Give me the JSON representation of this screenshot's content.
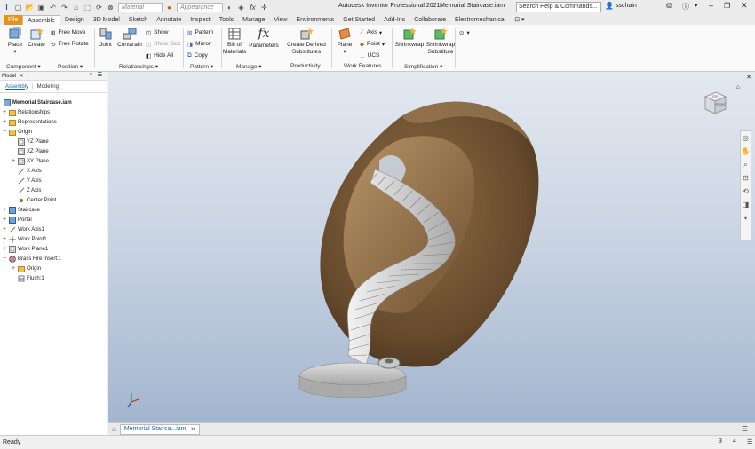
{
  "window": {
    "app_title": "Autodesk Inventor Professional 2021",
    "doc_title": "Memorial Staircase.iam",
    "search_placeholder": "Search Help & Commands...",
    "user": "sschain",
    "material_placeholder": "Material",
    "appearance_placeholder": "Appearance"
  },
  "tabs": [
    "File",
    "Assemble",
    "Design",
    "3D Model",
    "Sketch",
    "Annotate",
    "Inspect",
    "Tools",
    "Manage",
    "View",
    "Environments",
    "Get Started",
    "Add-Ins",
    "Collaborate",
    "Electromechanical"
  ],
  "active_tab": "Assemble",
  "ribbon": {
    "place": "Place",
    "create": "Create",
    "free_move": "Free Move",
    "free_rotate": "Free Rotate",
    "joint": "Joint",
    "constrain": "Constrain",
    "show": "Show",
    "show_sick": "Show Sick",
    "hide_all": "Hide All",
    "pattern": "Pattern",
    "mirror": "Mirror",
    "copy": "Copy",
    "bill_of_materials_1": "Bill of",
    "bill_of_materials_2": "Materials",
    "parameters": "Parameters",
    "create_derived_1": "Create Derived",
    "create_derived_2": "Substitutes",
    "plane": "Plane",
    "axis": "Axis",
    "point": "Point",
    "ucs": "UCS",
    "shrinkwrap": "Shrinkwrap",
    "shrinkwrap_sub_1": "Shrinkwrap",
    "shrinkwrap_sub_2": "Substitute",
    "panels": {
      "component": "Component ▾",
      "position": "Position ▾",
      "relationships": "Relationships ▾",
      "pattern": "Pattern ▾",
      "manage": "Manage ▾",
      "productivity": "Productivity",
      "work_features": "Work Features",
      "simplification": "Simplification ▾"
    }
  },
  "browser": {
    "title": "Model",
    "tab_assembly": "Assembly",
    "tab_modeling": "Modeling",
    "nodes": [
      {
        "label": "Memorial Staircase.iam",
        "icon": "assembly-icon"
      },
      {
        "label": "Relationships",
        "icon": "folder-icon"
      },
      {
        "label": "Representations",
        "icon": "folder-icon"
      },
      {
        "label": "Origin",
        "icon": "folder-icon"
      },
      {
        "label": "YZ Plane",
        "icon": "plane-icon"
      },
      {
        "label": "XZ Plane",
        "icon": "plane-icon"
      },
      {
        "label": "XY Plane",
        "icon": "plane-icon"
      },
      {
        "label": "X Axis",
        "icon": "axis-icon"
      },
      {
        "label": "Y Axis",
        "icon": "axis-icon"
      },
      {
        "label": "Z Axis",
        "icon": "axis-icon"
      },
      {
        "label": "Center Point",
        "icon": "point-icon"
      },
      {
        "label": "Staircase",
        "icon": "part-icon"
      },
      {
        "label": "Portal",
        "icon": "part-icon"
      },
      {
        "label": "Work Axis1",
        "icon": "axis-icon"
      },
      {
        "label": "Work Point1",
        "icon": "point-icon"
      },
      {
        "label": "Work Plane1",
        "icon": "plane-icon"
      },
      {
        "label": "Brass Fire Insert:1",
        "icon": "subassembly-icon"
      },
      {
        "label": "Origin",
        "icon": "folder-icon"
      },
      {
        "label": "Flush:1",
        "icon": "constraint-icon"
      }
    ]
  },
  "viewcube": {
    "top": "TOP",
    "front": "FRONT"
  },
  "doc_tab": "Memorial Stairca...iam",
  "status": {
    "text": "Ready",
    "count1": "3",
    "count2": "4"
  }
}
